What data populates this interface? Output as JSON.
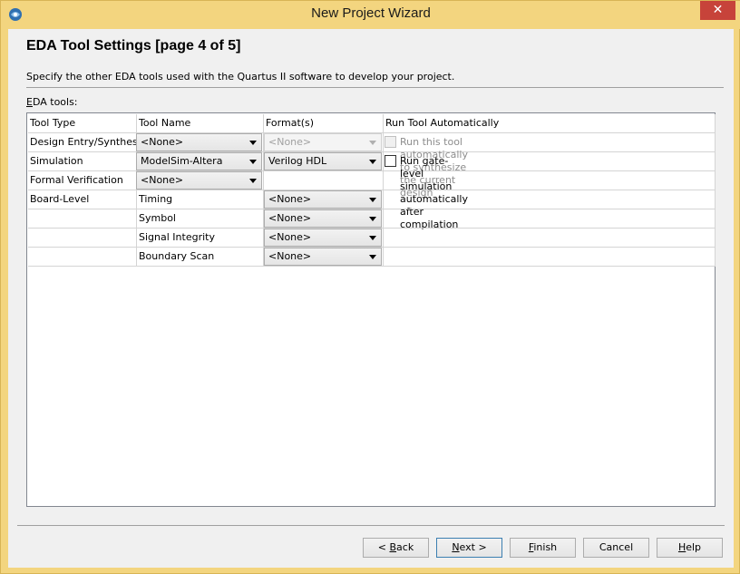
{
  "window": {
    "title": "New Project Wizard",
    "close_glyph": "✕"
  },
  "header": {
    "title": "EDA Tool Settings [page 4 of 5]",
    "description": "Specify the other EDA tools used with the Quartus II software to develop your project."
  },
  "eda_tools_label": {
    "mnemonic": "E",
    "rest": "DA tools:"
  },
  "table": {
    "columns": [
      "Tool Type",
      "Tool Name",
      "Format(s)",
      "Run Tool Automatically"
    ],
    "rows": [
      {
        "tool_type": "Design Entry/Synthesis",
        "tool_name": "<None>",
        "format": "<None>",
        "run_auto": "Run this tool automatically to synthesize the current design",
        "format_disabled": true,
        "run_disabled": true
      },
      {
        "tool_type": "Simulation",
        "tool_name": "ModelSim-Altera",
        "format": "Verilog HDL",
        "run_auto": "Run gate-level simulation automatically after compilation"
      },
      {
        "tool_type": "Formal Verification",
        "tool_name": "<None>"
      },
      {
        "tool_type": "Board-Level",
        "tool_name_label": "Timing",
        "format": "<None>"
      },
      {
        "tool_type": "",
        "tool_name_label": "Symbol",
        "format": "<None>"
      },
      {
        "tool_type": "",
        "tool_name_label": "Signal Integrity",
        "format": "<None>"
      },
      {
        "tool_type": "",
        "tool_name_label": "Boundary Scan",
        "format": "<None>"
      }
    ]
  },
  "buttons": {
    "back": {
      "prefix": "< ",
      "mnemonic": "B",
      "rest": "ack"
    },
    "next": {
      "mnemonic": "N",
      "rest": "ext >"
    },
    "finish": {
      "mnemonic": "F",
      "rest": "inish"
    },
    "cancel": {
      "label": "Cancel"
    },
    "help": {
      "mnemonic": "H",
      "rest": "elp"
    }
  },
  "colors": {
    "frame": "#f3d57f",
    "close": "#c7433a",
    "client": "#f0f0f0"
  }
}
